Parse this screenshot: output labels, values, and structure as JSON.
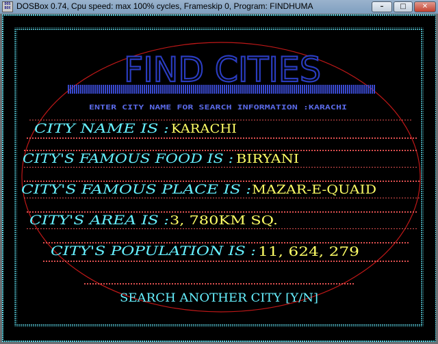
{
  "window": {
    "title": "DOSBox 0.74, Cpu speed: max 100% cycles, Frameskip  0, Program: FINDHUMA",
    "icon_text": [
      "DOS",
      "BOX"
    ],
    "controls": {
      "minimize": "–",
      "maximize": "□",
      "close": "✕"
    }
  },
  "program": {
    "heading": "FIND CITIES",
    "prompt": "ENTER CITY NAME FOR SEARCH INFORMATION :KARACHI",
    "fields": [
      {
        "label": "CITY NAME IS :",
        "value": "KARACHI"
      },
      {
        "label": "CITY'S FAMOUS FOOD IS :",
        "value": "BIRYANI"
      },
      {
        "label": "CITY'S FAMOUS PLACE IS :",
        "value": "MAZAR-E-QUAID"
      },
      {
        "label": "CITY'S AREA IS :",
        "value": "3, 780KM SQ."
      },
      {
        "label": "CITY'S POPULATION IS :",
        "value": "11, 624, 279"
      }
    ],
    "footer": "SEARCH ANOTHER CITY [Y/N]"
  },
  "colors": {
    "background": "#000000",
    "border_dots": "#5ad6e6",
    "ellipse": "#c01818",
    "heading": "#2a3cc0",
    "heading_bar": "#3a4ad0",
    "prompt": "#5a6ae8",
    "label": "#66f0ff",
    "value": "#ffff66",
    "row_dots": "#e05050",
    "footer": "#66f0ff"
  }
}
